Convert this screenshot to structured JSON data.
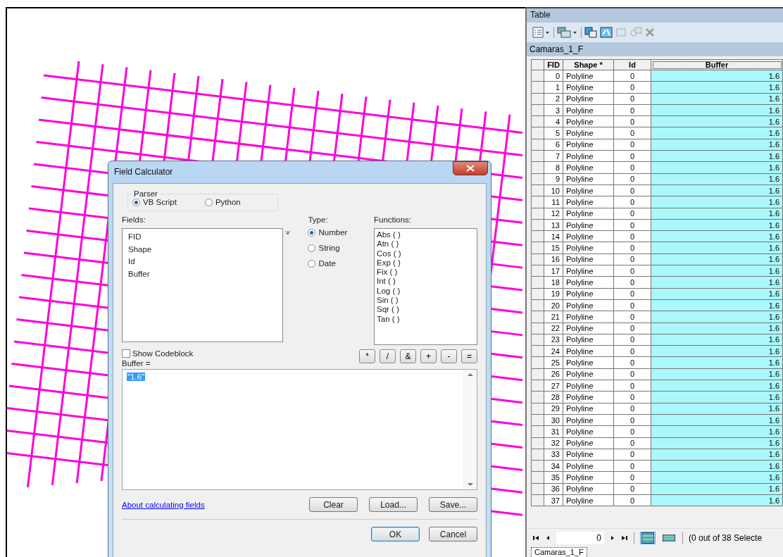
{
  "table_window": {
    "title": "Table",
    "layer_tab": "Camaras_1_F",
    "columns": [
      "FID",
      "Shape *",
      "Id",
      "Buffer"
    ],
    "rows": [
      {
        "fid": "0",
        "shape": "Polyline",
        "id": "0",
        "buffer": "1.6"
      },
      {
        "fid": "1",
        "shape": "Polyline",
        "id": "0",
        "buffer": "1.6"
      },
      {
        "fid": "2",
        "shape": "Polyline",
        "id": "0",
        "buffer": "1.6"
      },
      {
        "fid": "3",
        "shape": "Polyline",
        "id": "0",
        "buffer": "1.6"
      },
      {
        "fid": "4",
        "shape": "Polyline",
        "id": "0",
        "buffer": "1.6"
      },
      {
        "fid": "5",
        "shape": "Polyline",
        "id": "0",
        "buffer": "1.6"
      },
      {
        "fid": "6",
        "shape": "Polyline",
        "id": "0",
        "buffer": "1.6"
      },
      {
        "fid": "7",
        "shape": "Polyline",
        "id": "0",
        "buffer": "1.6"
      },
      {
        "fid": "8",
        "shape": "Polyline",
        "id": "0",
        "buffer": "1.6"
      },
      {
        "fid": "9",
        "shape": "Polyline",
        "id": "0",
        "buffer": "1.6"
      },
      {
        "fid": "10",
        "shape": "Polyline",
        "id": "0",
        "buffer": "1.6"
      },
      {
        "fid": "11",
        "shape": "Polyline",
        "id": "0",
        "buffer": "1.6"
      },
      {
        "fid": "12",
        "shape": "Polyline",
        "id": "0",
        "buffer": "1.6"
      },
      {
        "fid": "13",
        "shape": "Polyline",
        "id": "0",
        "buffer": "1.6"
      },
      {
        "fid": "14",
        "shape": "Polyline",
        "id": "0",
        "buffer": "1.6"
      },
      {
        "fid": "15",
        "shape": "Polyline",
        "id": "0",
        "buffer": "1.6"
      },
      {
        "fid": "16",
        "shape": "Polyline",
        "id": "0",
        "buffer": "1.6"
      },
      {
        "fid": "17",
        "shape": "Polyline",
        "id": "0",
        "buffer": "1.6"
      },
      {
        "fid": "18",
        "shape": "Polyline",
        "id": "0",
        "buffer": "1.6"
      },
      {
        "fid": "19",
        "shape": "Polyline",
        "id": "0",
        "buffer": "1.6"
      },
      {
        "fid": "20",
        "shape": "Polyline",
        "id": "0",
        "buffer": "1.6"
      },
      {
        "fid": "21",
        "shape": "Polyline",
        "id": "0",
        "buffer": "1.6"
      },
      {
        "fid": "22",
        "shape": "Polyline",
        "id": "0",
        "buffer": "1.6"
      },
      {
        "fid": "23",
        "shape": "Polyline",
        "id": "0",
        "buffer": "1.6"
      },
      {
        "fid": "24",
        "shape": "Polyline",
        "id": "0",
        "buffer": "1.6"
      },
      {
        "fid": "25",
        "shape": "Polyline",
        "id": "0",
        "buffer": "1.6"
      },
      {
        "fid": "26",
        "shape": "Polyline",
        "id": "0",
        "buffer": "1.6"
      },
      {
        "fid": "27",
        "shape": "Polyline",
        "id": "0",
        "buffer": "1.6"
      },
      {
        "fid": "28",
        "shape": "Polyline",
        "id": "0",
        "buffer": "1.6"
      },
      {
        "fid": "29",
        "shape": "Polyline",
        "id": "0",
        "buffer": "1.6"
      },
      {
        "fid": "30",
        "shape": "Polyline",
        "id": "0",
        "buffer": "1.6"
      },
      {
        "fid": "31",
        "shape": "Polyline",
        "id": "0",
        "buffer": "1.6"
      },
      {
        "fid": "32",
        "shape": "Polyline",
        "id": "0",
        "buffer": "1.6"
      },
      {
        "fid": "33",
        "shape": "Polyline",
        "id": "0",
        "buffer": "1.6"
      },
      {
        "fid": "34",
        "shape": "Polyline",
        "id": "0",
        "buffer": "1.6"
      },
      {
        "fid": "35",
        "shape": "Polyline",
        "id": "0",
        "buffer": "1.6"
      },
      {
        "fid": "36",
        "shape": "Polyline",
        "id": "0",
        "buffer": "1.6"
      },
      {
        "fid": "37",
        "shape": "Polyline",
        "id": "0",
        "buffer": "1.6"
      }
    ],
    "record_field": {
      "value": "0"
    },
    "selection_status": "(0 out of 38 Selecte",
    "view_buttons": [
      {
        "kind": "all",
        "selected": true
      },
      {
        "kind": "selected",
        "selected": false
      }
    ],
    "bottom_tab": "Camaras_1_F"
  },
  "dialog": {
    "title": "Field Calculator",
    "parser": {
      "label": "Parser",
      "options": [
        {
          "label": "VB Script",
          "selected": true
        },
        {
          "label": "Python",
          "selected": false
        }
      ]
    },
    "fields_label": "Fields:",
    "fields": [
      "FID",
      "Shape",
      "Id",
      "Buffer"
    ],
    "type_label": "Type:",
    "types": [
      {
        "label": "Number",
        "selected": true
      },
      {
        "label": "String",
        "selected": false
      },
      {
        "label": "Date",
        "selected": false
      }
    ],
    "functions_label": "Functions:",
    "functions": [
      "Abs ( )",
      "Atn ( )",
      "Cos ( )",
      "Exp ( )",
      "Fix ( )",
      "Int ( )",
      "Log ( )",
      "Sin ( )",
      "Sqr ( )",
      "Tan ( )"
    ],
    "show_codeblock": {
      "label": "Show Codeblock",
      "checked": false
    },
    "operators": [
      "*",
      "/",
      "&",
      "+",
      "-",
      "="
    ],
    "expression_label": "Buffer =",
    "expression": {
      "value": "\"1.6\"",
      "selected": true
    },
    "help_link": "About calculating fields",
    "file_buttons": [
      "Clear",
      "Load...",
      "Save..."
    ],
    "buttons": [
      {
        "label": "OK",
        "default": true
      },
      {
        "label": "Cancel",
        "default": false
      }
    ]
  }
}
